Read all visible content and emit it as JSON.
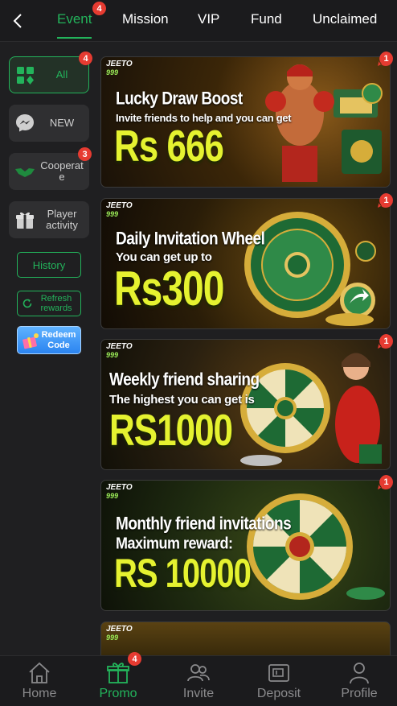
{
  "tabs": [
    {
      "label": "Event",
      "badge": "4",
      "active": true
    },
    {
      "label": "Mission"
    },
    {
      "label": "VIP"
    },
    {
      "label": "Fund"
    },
    {
      "label": "Unclaimed"
    }
  ],
  "sidebar": {
    "categories": [
      {
        "label": "All",
        "icon": "grid-icon",
        "badge": "4",
        "active": true
      },
      {
        "label": "NEW",
        "icon": "messenger-icon"
      },
      {
        "label": "Cooperat\ne",
        "icon": "handshake-icon",
        "badge": "3"
      },
      {
        "label": "Player activity",
        "icon": "gift-box-icon"
      }
    ],
    "history_label": "History",
    "refresh_label": "Refresh rewards",
    "redeem_label": "Redeem Code"
  },
  "banners": [
    {
      "logo": "JEETO",
      "logo_sub": "999",
      "title": "Lucky Draw Boost",
      "subtitle": "Invite friends to help and you can get",
      "amount": "Rs 666",
      "badge": "1"
    },
    {
      "logo": "JEETO",
      "logo_sub": "999",
      "title": "Daily Invitation Wheel",
      "subtitle": "You can get up to",
      "amount": "Rs300",
      "badge": "1"
    },
    {
      "logo": "JEETO",
      "logo_sub": "999",
      "title": "Weekly friend sharing",
      "subtitle": "The highest you can get is",
      "amount": "RS1000",
      "badge": "1"
    },
    {
      "logo": "JEETO",
      "logo_sub": "999",
      "title": "Monthly friend invitations",
      "subtitle": "Maximum reward:",
      "amount": "RS 10000",
      "badge": "1"
    },
    {
      "logo": "JEETO",
      "logo_sub": "999"
    }
  ],
  "bottom_nav": [
    {
      "label": "Home",
      "icon": "home-icon"
    },
    {
      "label": "Promo",
      "icon": "gift-icon",
      "badge": "4",
      "active": true
    },
    {
      "label": "Invite",
      "icon": "people-icon"
    },
    {
      "label": "Deposit",
      "icon": "wallet-icon"
    },
    {
      "label": "Profile",
      "icon": "person-icon"
    }
  ],
  "colors": {
    "accent": "#23b35b",
    "badge": "#e63b31",
    "amount": "#e5f230",
    "background": "#1f1f21"
  }
}
